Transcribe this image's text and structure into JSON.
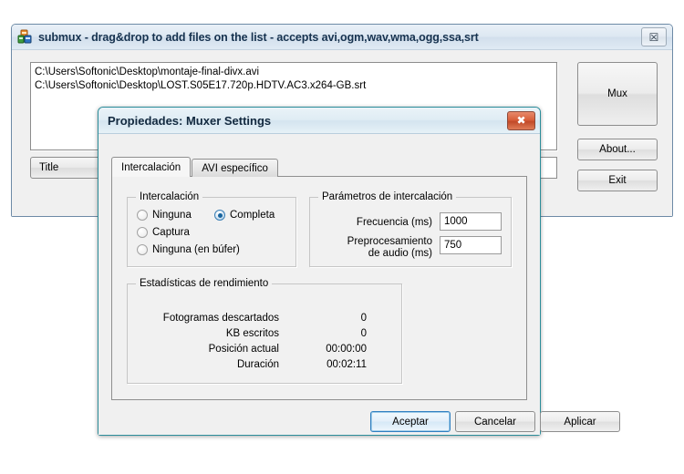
{
  "main_window": {
    "title": "submux - drag&drop to add files on the list - accepts avi,ogm,wav,wma,ogg,ssa,srt",
    "icon": "submux-app-icon",
    "close_glyph": "☒",
    "file_list": [
      "C:\\Users\\Softonic\\Desktop\\montaje-final-divx.avi",
      "C:\\Users\\Softonic\\Desktop\\LOST.S05E17.720p.HDTV.AC3.x264-GB.srt"
    ],
    "title_field": {
      "label": "Title",
      "value": "",
      "placeholder": ""
    },
    "buttons": {
      "mux": "Mux",
      "about": "About...",
      "exit": "Exit"
    }
  },
  "dialog": {
    "title": "Propiedades: Muxer Settings",
    "close_glyph": "✖",
    "tabs": [
      {
        "label": "Intercalación",
        "active": true
      },
      {
        "label": "AVI específico",
        "active": false
      }
    ],
    "interleave_group": {
      "title": "Intercalación",
      "options": [
        {
          "label": "Ninguna",
          "checked": false
        },
        {
          "label": "Captura",
          "checked": false
        },
        {
          "label": "Ninguna (en búfer)",
          "checked": false
        },
        {
          "label": "Completa",
          "checked": true
        }
      ]
    },
    "params_group": {
      "title": "Parámetros de intercalación",
      "fields": [
        {
          "label": "Frecuencia (ms)",
          "value": "1000"
        },
        {
          "label": "Preprocesamiento\nde audio (ms)",
          "label_line1": "Preprocesamiento",
          "label_line2": "de audio (ms)",
          "value": "750"
        }
      ]
    },
    "stats_group": {
      "title": "Estadísticas de rendimiento",
      "rows": [
        {
          "label": "Fotogramas descartados",
          "value": "0"
        },
        {
          "label": "KB escritos",
          "value": "0"
        },
        {
          "label": "Posición actual",
          "value": "00:00:00"
        },
        {
          "label": "Duración",
          "value": "00:02:11"
        }
      ]
    },
    "buttons": {
      "accept": "Aceptar",
      "cancel": "Cancelar",
      "apply": "Aplicar"
    }
  },
  "colors": {
    "dialog_border": "#2b8d9a",
    "close_red": "#d9603b",
    "radio_accent": "#18649e",
    "default_button_border": "#2f7fc1",
    "title_text": "#16324f"
  }
}
